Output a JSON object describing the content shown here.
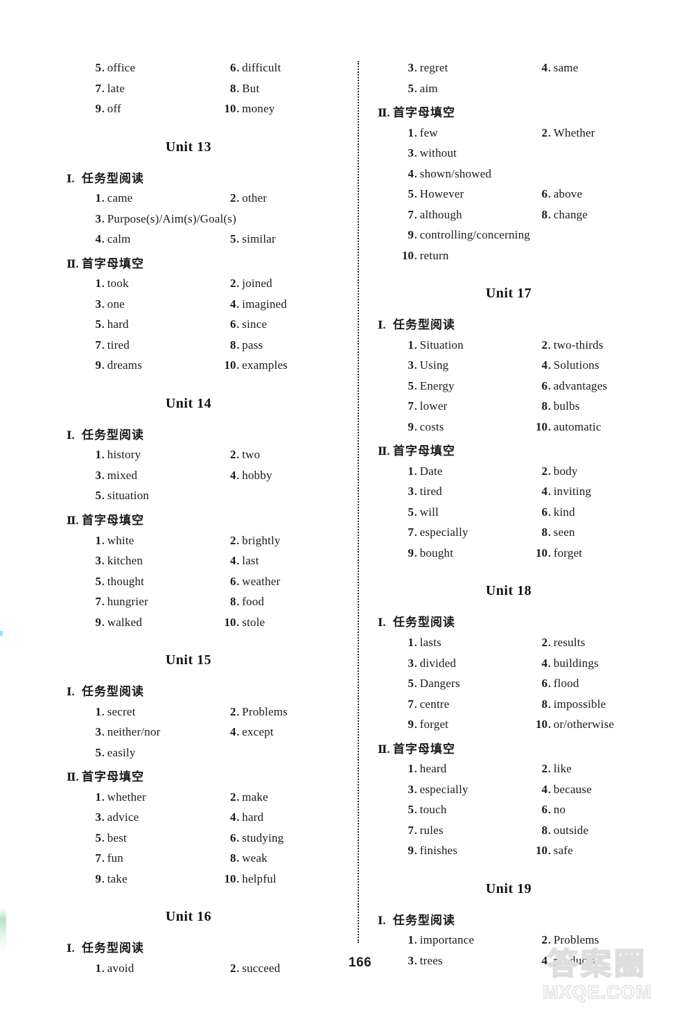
{
  "page": {
    "page_number": "166",
    "watermark_chinese": "答案圈",
    "watermark_site": "MXQE.COM"
  },
  "labels": {
    "roman_1": "Ⅰ.",
    "roman_2": "Ⅱ.",
    "section_reading": "任务型阅读",
    "section_firstletter": "首字母填空",
    "dot": "."
  },
  "left_column": {
    "continued_answers": [
      {
        "num": "5",
        "text": "office"
      },
      {
        "num": "6",
        "text": "difficult"
      },
      {
        "num": "7",
        "text": "late"
      },
      {
        "num": "8",
        "text": "But"
      },
      {
        "num": "9",
        "text": "off"
      },
      {
        "num": "10",
        "text": "money"
      }
    ],
    "units": [
      {
        "title": "Unit 13",
        "sections": [
          {
            "roman": "Ⅰ.",
            "heading": "任务型阅读",
            "answers": [
              {
                "num": "1",
                "text": "came",
                "wide": false
              },
              {
                "num": "2",
                "text": "other",
                "wide": false
              },
              {
                "num": "3",
                "text": "Purpose(s)/Aim(s)/Goal(s)",
                "wide": true
              },
              {
                "num": "4",
                "text": "calm",
                "wide": false
              },
              {
                "num": "5",
                "text": "similar",
                "wide": false
              }
            ]
          },
          {
            "roman": "Ⅱ.",
            "heading": "首字母填空",
            "answers": [
              {
                "num": "1",
                "text": "took",
                "wide": false
              },
              {
                "num": "2",
                "text": "joined",
                "wide": false
              },
              {
                "num": "3",
                "text": "one",
                "wide": false
              },
              {
                "num": "4",
                "text": "imagined",
                "wide": false
              },
              {
                "num": "5",
                "text": "hard",
                "wide": false
              },
              {
                "num": "6",
                "text": "since",
                "wide": false
              },
              {
                "num": "7",
                "text": "tired",
                "wide": false
              },
              {
                "num": "8",
                "text": "pass",
                "wide": false
              },
              {
                "num": "9",
                "text": "dreams",
                "wide": false
              },
              {
                "num": "10",
                "text": "examples",
                "wide": false
              }
            ]
          }
        ]
      },
      {
        "title": "Unit 14",
        "sections": [
          {
            "roman": "Ⅰ.",
            "heading": "任务型阅读",
            "answers": [
              {
                "num": "1",
                "text": "history",
                "wide": false
              },
              {
                "num": "2",
                "text": "two",
                "wide": false
              },
              {
                "num": "3",
                "text": "mixed",
                "wide": false
              },
              {
                "num": "4",
                "text": "hobby",
                "wide": false
              },
              {
                "num": "5",
                "text": "situation",
                "wide": false
              }
            ]
          },
          {
            "roman": "Ⅱ.",
            "heading": "首字母填空",
            "answers": [
              {
                "num": "1",
                "text": "white",
                "wide": false
              },
              {
                "num": "2",
                "text": "brightly",
                "wide": false
              },
              {
                "num": "3",
                "text": "kitchen",
                "wide": false
              },
              {
                "num": "4",
                "text": "last",
                "wide": false
              },
              {
                "num": "5",
                "text": "thought",
                "wide": false
              },
              {
                "num": "6",
                "text": "weather",
                "wide": false
              },
              {
                "num": "7",
                "text": "hungrier",
                "wide": false
              },
              {
                "num": "8",
                "text": "food",
                "wide": false
              },
              {
                "num": "9",
                "text": "walked",
                "wide": false
              },
              {
                "num": "10",
                "text": "stole",
                "wide": false
              }
            ]
          }
        ]
      },
      {
        "title": "Unit 15",
        "sections": [
          {
            "roman": "Ⅰ.",
            "heading": "任务型阅读",
            "answers": [
              {
                "num": "1",
                "text": "secret",
                "wide": false
              },
              {
                "num": "2",
                "text": "Problems",
                "wide": false
              },
              {
                "num": "3",
                "text": "neither/nor",
                "wide": false
              },
              {
                "num": "4",
                "text": "except",
                "wide": false
              },
              {
                "num": "5",
                "text": "easily",
                "wide": false
              }
            ]
          },
          {
            "roman": "Ⅱ.",
            "heading": "首字母填空",
            "answers": [
              {
                "num": "1",
                "text": "whether",
                "wide": false
              },
              {
                "num": "2",
                "text": "make",
                "wide": false
              },
              {
                "num": "3",
                "text": "advice",
                "wide": false
              },
              {
                "num": "4",
                "text": "hard",
                "wide": false
              },
              {
                "num": "5",
                "text": "best",
                "wide": false
              },
              {
                "num": "6",
                "text": "studying",
                "wide": false
              },
              {
                "num": "7",
                "text": "fun",
                "wide": false
              },
              {
                "num": "8",
                "text": "weak",
                "wide": false
              },
              {
                "num": "9",
                "text": "take",
                "wide": false
              },
              {
                "num": "10",
                "text": "helpful",
                "wide": false
              }
            ]
          }
        ]
      },
      {
        "title": "Unit 16",
        "sections": [
          {
            "roman": "Ⅰ.",
            "heading": "任务型阅读",
            "answers": [
              {
                "num": "1",
                "text": "avoid",
                "wide": false
              },
              {
                "num": "2",
                "text": "succeed",
                "wide": false
              }
            ]
          }
        ]
      }
    ]
  },
  "right_column": {
    "continued_answers": [
      {
        "num": "3",
        "text": "regret"
      },
      {
        "num": "4",
        "text": "same"
      },
      {
        "num": "5",
        "text": "aim"
      }
    ],
    "continued_section": {
      "roman": "Ⅱ.",
      "heading": "首字母填空",
      "answers": [
        {
          "num": "1",
          "text": "few",
          "wide": false
        },
        {
          "num": "2",
          "text": "Whether",
          "wide": false
        },
        {
          "num": "3",
          "text": "without",
          "wide": false
        },
        {
          "num": "4",
          "text": "shown/showed",
          "wide": true
        },
        {
          "num": "5",
          "text": "However",
          "wide": false
        },
        {
          "num": "6",
          "text": "above",
          "wide": false
        },
        {
          "num": "7",
          "text": "although",
          "wide": false
        },
        {
          "num": "8",
          "text": "change",
          "wide": false
        },
        {
          "num": "9",
          "text": "controlling/concerning",
          "wide": true
        },
        {
          "num": "10",
          "text": "return",
          "wide": true
        }
      ]
    },
    "units": [
      {
        "title": "Unit 17",
        "sections": [
          {
            "roman": "Ⅰ.",
            "heading": "任务型阅读",
            "answers": [
              {
                "num": "1",
                "text": "Situation",
                "wide": false
              },
              {
                "num": "2",
                "text": "two-thirds",
                "wide": false
              },
              {
                "num": "3",
                "text": "Using",
                "wide": false
              },
              {
                "num": "4",
                "text": "Solutions",
                "wide": false
              },
              {
                "num": "5",
                "text": "Energy",
                "wide": false
              },
              {
                "num": "6",
                "text": "advantages",
                "wide": false
              },
              {
                "num": "7",
                "text": "lower",
                "wide": false
              },
              {
                "num": "8",
                "text": "bulbs",
                "wide": false
              },
              {
                "num": "9",
                "text": "costs",
                "wide": false
              },
              {
                "num": "10",
                "text": "automatic",
                "wide": false
              }
            ]
          },
          {
            "roman": "Ⅱ.",
            "heading": "首字母填空",
            "answers": [
              {
                "num": "1",
                "text": "Date",
                "wide": false
              },
              {
                "num": "2",
                "text": "body",
                "wide": false
              },
              {
                "num": "3",
                "text": "tired",
                "wide": false
              },
              {
                "num": "4",
                "text": "inviting",
                "wide": false
              },
              {
                "num": "5",
                "text": "will",
                "wide": false
              },
              {
                "num": "6",
                "text": "kind",
                "wide": false
              },
              {
                "num": "7",
                "text": "especially",
                "wide": false
              },
              {
                "num": "8",
                "text": "seen",
                "wide": false
              },
              {
                "num": "9",
                "text": "bought",
                "wide": false
              },
              {
                "num": "10",
                "text": "forget",
                "wide": false
              }
            ]
          }
        ]
      },
      {
        "title": "Unit 18",
        "sections": [
          {
            "roman": "Ⅰ.",
            "heading": "任务型阅读",
            "answers": [
              {
                "num": "1",
                "text": "lasts",
                "wide": false
              },
              {
                "num": "2",
                "text": "results",
                "wide": false
              },
              {
                "num": "3",
                "text": "divided",
                "wide": false
              },
              {
                "num": "4",
                "text": "buildings",
                "wide": false
              },
              {
                "num": "5",
                "text": "Dangers",
                "wide": false
              },
              {
                "num": "6",
                "text": "flood",
                "wide": false
              },
              {
                "num": "7",
                "text": "centre",
                "wide": false
              },
              {
                "num": "8",
                "text": "impossible",
                "wide": false
              },
              {
                "num": "9",
                "text": "forget",
                "wide": false
              },
              {
                "num": "10",
                "text": "or/otherwise",
                "wide": false
              }
            ]
          },
          {
            "roman": "Ⅱ.",
            "heading": "首字母填空",
            "answers": [
              {
                "num": "1",
                "text": "heard",
                "wide": false
              },
              {
                "num": "2",
                "text": "like",
                "wide": false
              },
              {
                "num": "3",
                "text": "especially",
                "wide": false
              },
              {
                "num": "4",
                "text": "because",
                "wide": false
              },
              {
                "num": "5",
                "text": "touch",
                "wide": false
              },
              {
                "num": "6",
                "text": "no",
                "wide": false
              },
              {
                "num": "7",
                "text": "rules",
                "wide": false
              },
              {
                "num": "8",
                "text": "outside",
                "wide": false
              },
              {
                "num": "9",
                "text": "finishes",
                "wide": false
              },
              {
                "num": "10",
                "text": "safe",
                "wide": false
              }
            ]
          }
        ]
      },
      {
        "title": "Unit 19",
        "sections": [
          {
            "roman": "Ⅰ.",
            "heading": "任务型阅读",
            "answers": [
              {
                "num": "1",
                "text": "importance",
                "wide": false
              },
              {
                "num": "2",
                "text": "Problems",
                "wide": false
              },
              {
                "num": "3",
                "text": "trees",
                "wide": false
              },
              {
                "num": "4",
                "text": "products",
                "wide": false
              }
            ]
          }
        ]
      }
    ]
  }
}
